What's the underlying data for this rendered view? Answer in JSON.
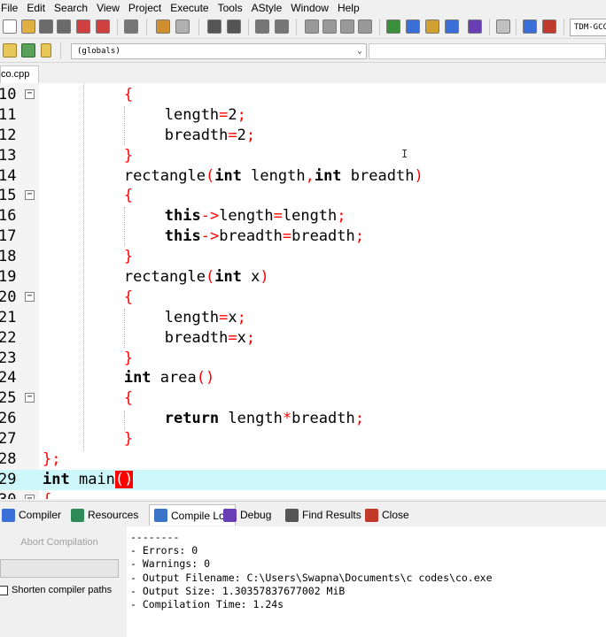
{
  "menu": [
    "File",
    "Edit",
    "Search",
    "View",
    "Project",
    "Execute",
    "Tools",
    "AStyle",
    "Window",
    "Help"
  ],
  "toolbar": {
    "compiler_select": "TDM-GCC",
    "scope_select": "(globals)"
  },
  "file_tab": "co.cpp",
  "editor": {
    "lines": [
      {
        "n": "10",
        "fold": true,
        "indent": 2,
        "html": [
          [
            "r",
            "{"
          ]
        ]
      },
      {
        "n": "11",
        "fold": false,
        "indent": 3,
        "html": [
          [
            "",
            "length"
          ],
          [
            "r",
            "="
          ],
          [
            "",
            "2"
          ],
          [
            "r",
            ";"
          ]
        ]
      },
      {
        "n": "12",
        "fold": false,
        "indent": 3,
        "html": [
          [
            "",
            "breadth"
          ],
          [
            "r",
            "="
          ],
          [
            "",
            "2"
          ],
          [
            "r",
            ";"
          ]
        ]
      },
      {
        "n": "13",
        "fold": false,
        "indent": 2,
        "html": [
          [
            "r",
            "}"
          ]
        ]
      },
      {
        "n": "14",
        "fold": false,
        "indent": 2,
        "html": [
          [
            "",
            "rectangle"
          ],
          [
            "r",
            "("
          ],
          [
            "k",
            "int"
          ],
          [
            "",
            " length"
          ],
          [
            "r",
            ","
          ],
          [
            "k",
            "int"
          ],
          [
            "",
            " breadth"
          ],
          [
            "r",
            ")"
          ]
        ]
      },
      {
        "n": "15",
        "fold": true,
        "indent": 2,
        "html": [
          [
            "r",
            "{"
          ]
        ]
      },
      {
        "n": "16",
        "fold": false,
        "indent": 3,
        "html": [
          [
            "k",
            "this"
          ],
          [
            "r",
            "->"
          ],
          [
            "",
            "length"
          ],
          [
            "r",
            "="
          ],
          [
            "",
            "length"
          ],
          [
            "r",
            ";"
          ]
        ]
      },
      {
        "n": "17",
        "fold": false,
        "indent": 3,
        "html": [
          [
            "k",
            "this"
          ],
          [
            "r",
            "->"
          ],
          [
            "",
            "breadth"
          ],
          [
            "r",
            "="
          ],
          [
            "",
            "breadth"
          ],
          [
            "r",
            ";"
          ]
        ]
      },
      {
        "n": "18",
        "fold": false,
        "indent": 2,
        "html": [
          [
            "r",
            "}"
          ]
        ]
      },
      {
        "n": "19",
        "fold": false,
        "indent": 2,
        "html": [
          [
            "",
            "rectangle"
          ],
          [
            "r",
            "("
          ],
          [
            "k",
            "int"
          ],
          [
            "",
            " x"
          ],
          [
            "r",
            ")"
          ]
        ]
      },
      {
        "n": "20",
        "fold": true,
        "indent": 2,
        "html": [
          [
            "r",
            "{"
          ]
        ]
      },
      {
        "n": "21",
        "fold": false,
        "indent": 3,
        "html": [
          [
            "",
            "length"
          ],
          [
            "r",
            "="
          ],
          [
            "",
            "x"
          ],
          [
            "r",
            ";"
          ]
        ]
      },
      {
        "n": "22",
        "fold": false,
        "indent": 3,
        "html": [
          [
            "",
            "breadth"
          ],
          [
            "r",
            "="
          ],
          [
            "",
            "x"
          ],
          [
            "r",
            ";"
          ]
        ]
      },
      {
        "n": "23",
        "fold": false,
        "indent": 2,
        "html": [
          [
            "r",
            "}"
          ]
        ]
      },
      {
        "n": "24",
        "fold": false,
        "indent": 2,
        "html": [
          [
            "k",
            "int"
          ],
          [
            "",
            " area"
          ],
          [
            "r",
            "()"
          ]
        ]
      },
      {
        "n": "25",
        "fold": true,
        "indent": 2,
        "html": [
          [
            "r",
            "{"
          ]
        ]
      },
      {
        "n": "26",
        "fold": false,
        "indent": 3,
        "html": [
          [
            "k",
            "return"
          ],
          [
            "",
            " length"
          ],
          [
            "r",
            "*"
          ],
          [
            "",
            "breadth"
          ],
          [
            "r",
            ";"
          ]
        ]
      },
      {
        "n": "27",
        "fold": false,
        "indent": 2,
        "html": [
          [
            "r",
            "}"
          ]
        ]
      },
      {
        "n": "28",
        "fold": false,
        "indent": 0,
        "html": [
          [
            "r",
            "};"
          ]
        ]
      },
      {
        "n": "29",
        "fold": false,
        "indent": 0,
        "hl": true,
        "html": [
          [
            "k",
            "int"
          ],
          [
            "",
            " main"
          ],
          [
            "sel",
            "()"
          ]
        ]
      },
      {
        "n": "30",
        "fold": true,
        "indent": 0,
        "html": [
          [
            "r",
            "{"
          ]
        ]
      }
    ]
  },
  "panel_tabs": [
    {
      "label": "Compiler",
      "icon": "compiler-icon",
      "color": "#3a6fd8"
    },
    {
      "label": "Resources",
      "icon": "resources-icon",
      "color": "#2e8b57"
    },
    {
      "label": "Compile Log",
      "icon": "compile-log-icon",
      "color": "#3b73c8",
      "active": true
    },
    {
      "label": "Debug",
      "icon": "debug-check-icon",
      "color": "#6a3fb5"
    },
    {
      "label": "Find Results",
      "icon": "find-results-icon",
      "color": "#555555"
    },
    {
      "label": "Close",
      "icon": "close-icon",
      "color": "#c0392b"
    }
  ],
  "compile": {
    "abort_label": "Abort Compilation",
    "shorten_label": "Shorten compiler paths",
    "log": [
      "--------",
      "- Errors: 0",
      "- Warnings: 0",
      "- Output Filename: C:\\Users\\Swapna\\Documents\\c codes\\co.exe",
      "- Output Size: 1.30357837677002 MiB",
      "- Compilation Time: 1.24s"
    ]
  }
}
